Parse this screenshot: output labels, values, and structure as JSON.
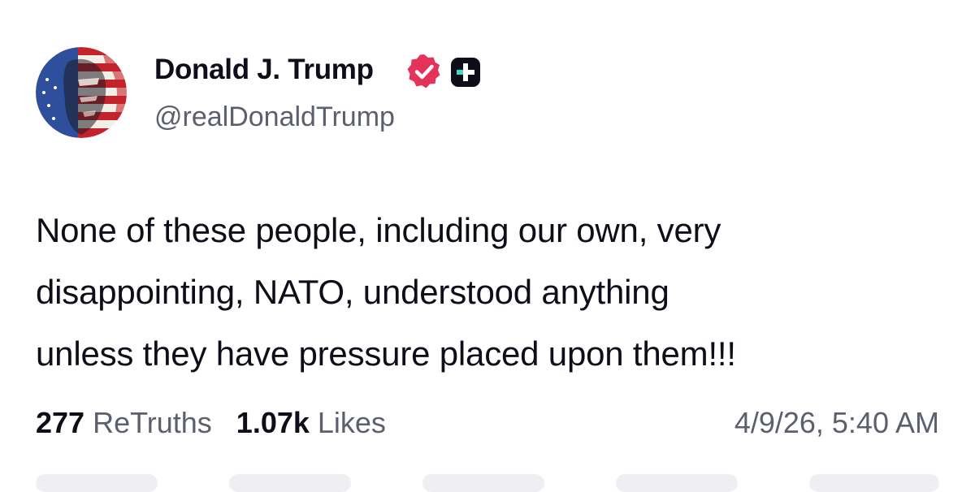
{
  "author": {
    "display_name": "Donald J. Trump",
    "handle": "@realDonaldTrump",
    "avatar_icon": "flag-portrait-avatar",
    "verified_icon": "verified-check-icon",
    "badge_icon": "plus-badge-icon",
    "verified_color": "#e5325b",
    "badge_color": "#0e0e1a",
    "badge_accent": "#49d4c8"
  },
  "post": {
    "text_lines": [
      "None of these people, including our own, very",
      "disappointing, NATO, understood anything",
      "unless they have pressure placed upon them!!!"
    ]
  },
  "stats": {
    "retruths_count": "277",
    "retruths_label": "ReTruths",
    "likes_count": "1.07k",
    "likes_label": "Likes",
    "timestamp": "4/9/26, 5:40 AM"
  },
  "colors": {
    "text_primary": "#0e0e1a",
    "text_secondary": "#5c5f6e",
    "background": "#ffffff"
  }
}
